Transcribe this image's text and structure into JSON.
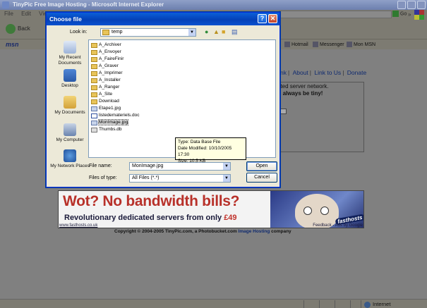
{
  "browser": {
    "title": "TinyPic Free Image Hosting - Microsoft Internet Explorer",
    "menu": [
      "File",
      "Edit",
      "View"
    ],
    "back_label": "Back",
    "go_label": "Go",
    "links_chevron": "»",
    "msn_logo": "msn",
    "msn_buttons": [
      "Hotmail",
      "Messenger",
      "Mon MSN"
    ],
    "status_zone": "Internet"
  },
  "page": {
    "nav_links": [
      "nk",
      "About",
      "Link to Us",
      "Donate"
    ],
    "box_line1": "ated server network.",
    "box_line2_pre": "ill ",
    "box_line2_bold": "always be tiny!",
    "banner": {
      "headline": "Wot? No bandwidth bills?",
      "subline_pre": "Revolutionary dedicated servers from only ",
      "subline_price": "£49",
      "brand": "fasthosts",
      "foot_left": "www.fasthosts.co.uk",
      "foot_right": "Feedback - Ads by Google"
    },
    "copyright_pre": "Copyright © 2004-2005 TinyPic.com, a Photobucket.com ",
    "copyright_link": "Image Hosting",
    "copyright_post": " company"
  },
  "dialog": {
    "title": "Choose file",
    "help_glyph": "?",
    "close_glyph": "✕",
    "look_in_label": "Look in:",
    "look_in_value": "temp",
    "places": [
      "My Recent Documents",
      "Desktop",
      "My Documents",
      "My Computer",
      "My Network Places"
    ],
    "files": [
      {
        "name": "A_Archiver",
        "kind": "folder"
      },
      {
        "name": "A_Envoyer",
        "kind": "folder"
      },
      {
        "name": "A_FaireFinir",
        "kind": "folder"
      },
      {
        "name": "A_Graver",
        "kind": "folder"
      },
      {
        "name": "A_Imprimer",
        "kind": "folder"
      },
      {
        "name": "A_Installer",
        "kind": "folder"
      },
      {
        "name": "A_Ranger",
        "kind": "folder"
      },
      {
        "name": "A_Site",
        "kind": "folder"
      },
      {
        "name": "Download",
        "kind": "folder"
      },
      {
        "name": "Etape1.jpg",
        "kind": "img"
      },
      {
        "name": "listedemateriels.doc",
        "kind": "doc"
      },
      {
        "name": "MonImage.jpg",
        "kind": "img",
        "selected": true
      },
      {
        "name": "Thumbs.db",
        "kind": "db"
      }
    ],
    "tooltip": {
      "type": "Type: Data Base File",
      "modified": "Date Modified: 10/10/2005 17:30",
      "size": "Size: 10,5 KB"
    },
    "file_name_label": "File name:",
    "file_name_value": "MonImage.jpg",
    "file_type_label": "Files of type:",
    "file_type_value": "All Files (*.*)",
    "open_label": "Open",
    "cancel_label": "Cancel"
  }
}
